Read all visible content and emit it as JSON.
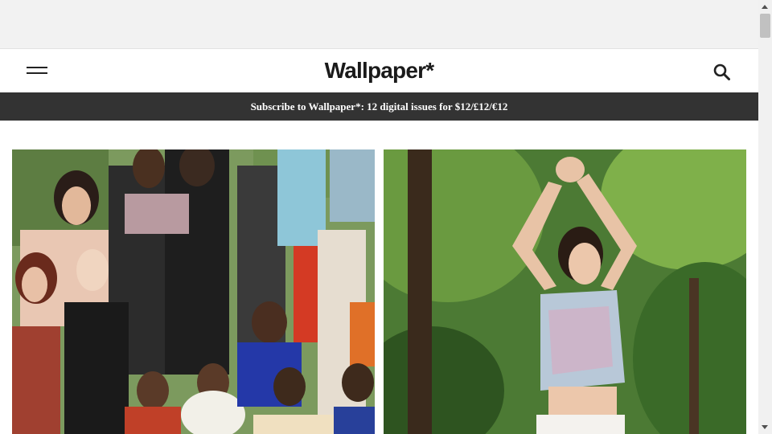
{
  "header": {
    "logo_text": "Wallpaper*",
    "menu_icon": "hamburger-menu-icon",
    "search_icon": "search-icon"
  },
  "banner": {
    "text": "Subscribe to Wallpaper*: 12 digital issues for $12/£12/€12"
  },
  "colors": {
    "banner_bg": "#333333",
    "ad_space_bg": "#f2f2f2"
  }
}
